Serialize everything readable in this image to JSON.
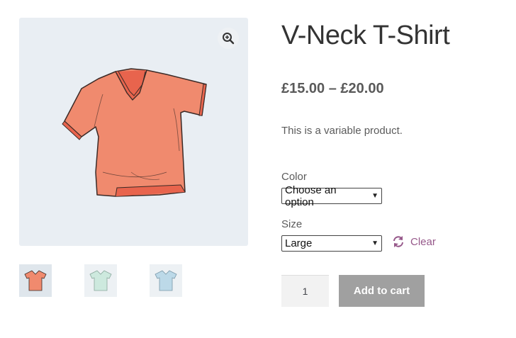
{
  "product": {
    "title": "V-Neck T-Shirt",
    "price": "£15.00 – £20.00",
    "description": "This is a variable product."
  },
  "gallery": {
    "zoom_icon": "magnify-plus-icon",
    "thumbnails": [
      {
        "color": "#f08a6e"
      },
      {
        "color": "#cde9de"
      },
      {
        "color": "#bcd9e8"
      }
    ]
  },
  "variations": {
    "color_label": "Color",
    "color_value": "Choose an option",
    "size_label": "Size",
    "size_value": "Large",
    "clear_label": "Clear",
    "clear_icon": "refresh-icon"
  },
  "cart": {
    "quantity": "1",
    "add_to_cart_label": "Add to cart"
  },
  "colors": {
    "shirt_main": "#f08a6e",
    "accent": "#96588a",
    "button": "#a0a0a0"
  }
}
